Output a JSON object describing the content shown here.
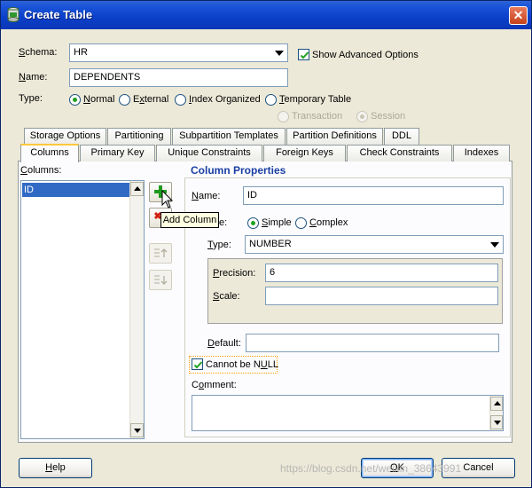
{
  "window": {
    "title": "Create Table",
    "close_glyph": "✕"
  },
  "form": {
    "schema_label": "Schema:",
    "schema_value": "HR",
    "show_advanced_label": "Show Advanced Options",
    "show_advanced_checked": true,
    "name_label": "Name:",
    "name_value": "DEPENDENTS",
    "type_label": "Type:",
    "type_options": [
      "Normal",
      "External",
      "Index Organized",
      "Temporary Table"
    ],
    "type_selected": "Normal",
    "temp_options": [
      "Transaction",
      "Session"
    ],
    "temp_selected": "Session"
  },
  "tabs_row1": [
    "Storage Options",
    "Partitioning",
    "Subpartition Templates",
    "Partition Definitions",
    "DDL"
  ],
  "tabs_row2": [
    "Columns",
    "Primary Key",
    "Unique Constraints",
    "Foreign Keys",
    "Check Constraints",
    "Indexes"
  ],
  "active_tab": "Columns",
  "columns_panel": {
    "columns_label": "Columns:",
    "columns": [
      "ID"
    ],
    "selected": "ID",
    "add_tooltip": "Add Column"
  },
  "column_properties": {
    "title": "Column Properties",
    "name_label": "Name:",
    "name_value": "ID",
    "datatype_label": "Datatype:",
    "datatype_label_visible": "e:",
    "datatype_options": [
      "Simple",
      "Complex"
    ],
    "datatype_selected": "Simple",
    "type_label": "Type:",
    "type_value": "NUMBER",
    "precision_label": "Precision:",
    "precision_value": "6",
    "scale_label": "Scale:",
    "scale_value": "",
    "default_label": "Default:",
    "default_value": "",
    "not_null_label": "Cannot be NULL",
    "not_null_checked": true,
    "comment_label": "Comment:",
    "comment_value": ""
  },
  "buttons": {
    "help": "Help",
    "ok": "OK",
    "cancel": "Cancel"
  },
  "watermark": "https://blog.csdn.net/weixin_38643991",
  "colors": {
    "titlebar": "#0a3fc9",
    "dialog_bg": "#ece9d8",
    "selection": "#316ac5",
    "section_title": "#1a3fa3"
  },
  "icons": [
    "app-icon",
    "close-icon",
    "add-icon",
    "remove-icon",
    "move-up-icon",
    "move-down-icon",
    "pointer-cursor-icon",
    "checkmark-icon"
  ]
}
